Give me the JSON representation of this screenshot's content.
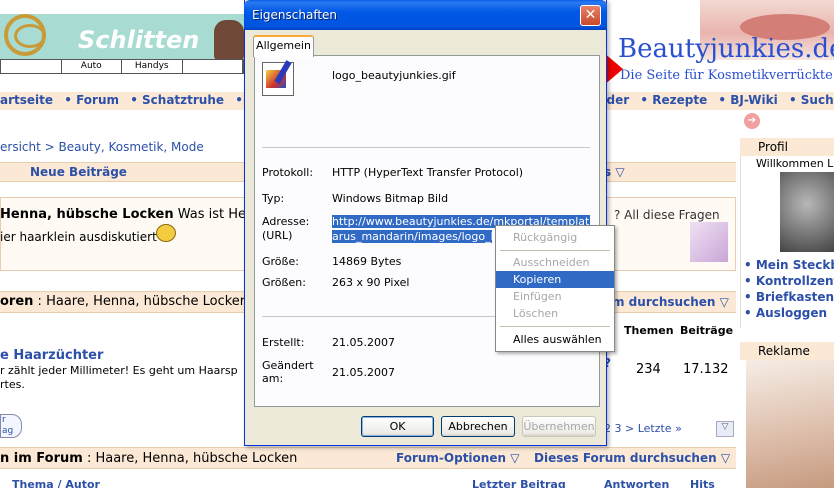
{
  "background": {
    "banner": {
      "schlitten_title": "Schlitten",
      "nav_cells": [
        "",
        "Auto",
        "Handys",
        ""
      ],
      "beauty_logo": "Beautyjunkies.de",
      "beauty_sub": "Die Seite für Kosmetikverrückte"
    },
    "mainnav_left": [
      "artseite",
      "• Forum",
      "• Schatztruhe",
      "• Tip"
    ],
    "mainnav_right": [
      "nder",
      "• Rezepte",
      "• BJ-Wiki",
      "• Suche"
    ],
    "breadcrumb": "ersicht > Beauty, Kosmetik, Mode",
    "neue_beitraege": "Neue Beiträge",
    "header_s": "s",
    "forum_info": {
      "title": "Henna, hübsche Locken",
      "desc_start": "Was ist Hen",
      "line2": "ier haarklein ausdiskutiert",
      "right_text": "? All diese Fragen"
    },
    "foren_prefix": "oren",
    "foren_title": "Haare, Henna, hübsche Locker",
    "forum_search": "m durchsuchen",
    "th_themen": "Themen",
    "th_beitraege": "Beiträge",
    "haar_title": "e Haarzüchter",
    "haar_desc1": "r zählt jeder Millimeter! Es geht um Haarsp",
    "haar_desc2": "rtes.",
    "qmark": "?",
    "num_themen": "234",
    "num_beitraege": "17.132",
    "new_button": "r\nag",
    "pager": "2   3   >   Letzte »",
    "im_forum_prefix": "n im Forum",
    "im_forum_title": "Haare, Henna, hübsche Locken",
    "forum_options": "Forum-Optionen",
    "forum_search_full": "Dieses Forum durchsuchen",
    "col_thema": "Thema / Autor",
    "col_letzter": "Letzter Beitrag",
    "col_antworten": "Antworten",
    "col_hits": "Hits",
    "profile": {
      "title": "Profil",
      "welcome": "Willkommen L",
      "links": [
        "Mein Steckb",
        "Kontrollzent",
        "Briefkasten",
        "Ausloggen"
      ]
    },
    "reklame_title": "Reklame"
  },
  "dialog": {
    "title": "Eigenschaften",
    "close_glyph": "✕",
    "tab": "Allgemein",
    "filename": "logo_beautyjunkies.gif",
    "properties": [
      {
        "label": "Protokoll:",
        "value": "HTTP (HyperText Transfer Protocol)"
      },
      {
        "label": "Typ:",
        "value": "Windows Bitmap Bild"
      },
      {
        "label": "Adresse:\n(URL)",
        "value": ""
      },
      {
        "label": "Größe:",
        "value": "14869 Bytes"
      },
      {
        "label": "Größen:",
        "value": "263  x  90  Pixel"
      },
      {
        "label": "Erstellt:",
        "value": "21.05.2007"
      },
      {
        "label": "Geändert\nam:",
        "value": "21.05.2007"
      }
    ],
    "url_line1": "http://www.beautyjunkies.de/mkportal/templates/act",
    "url_line2": "arus_mandarin/images/logo_beau",
    "buttons": {
      "ok": "OK",
      "cancel": "Abbrechen",
      "apply": "Übernehmen"
    }
  },
  "context_menu": {
    "items": [
      {
        "label": "Rückgängig",
        "enabled": false
      },
      {
        "label": "Ausschneiden",
        "enabled": false
      },
      {
        "label": "Kopieren",
        "enabled": true,
        "highlighted": true
      },
      {
        "label": "Einfügen",
        "enabled": false
      },
      {
        "label": "Löschen",
        "enabled": false
      },
      {
        "label": "Alles auswählen",
        "enabled": true
      }
    ]
  },
  "colors": {
    "link_blue": "#2c4fa8",
    "title_bar": "#0055e0",
    "selection": "#316ac5",
    "forum_bar": "#fbe9d6",
    "arrow": "#f00000"
  }
}
